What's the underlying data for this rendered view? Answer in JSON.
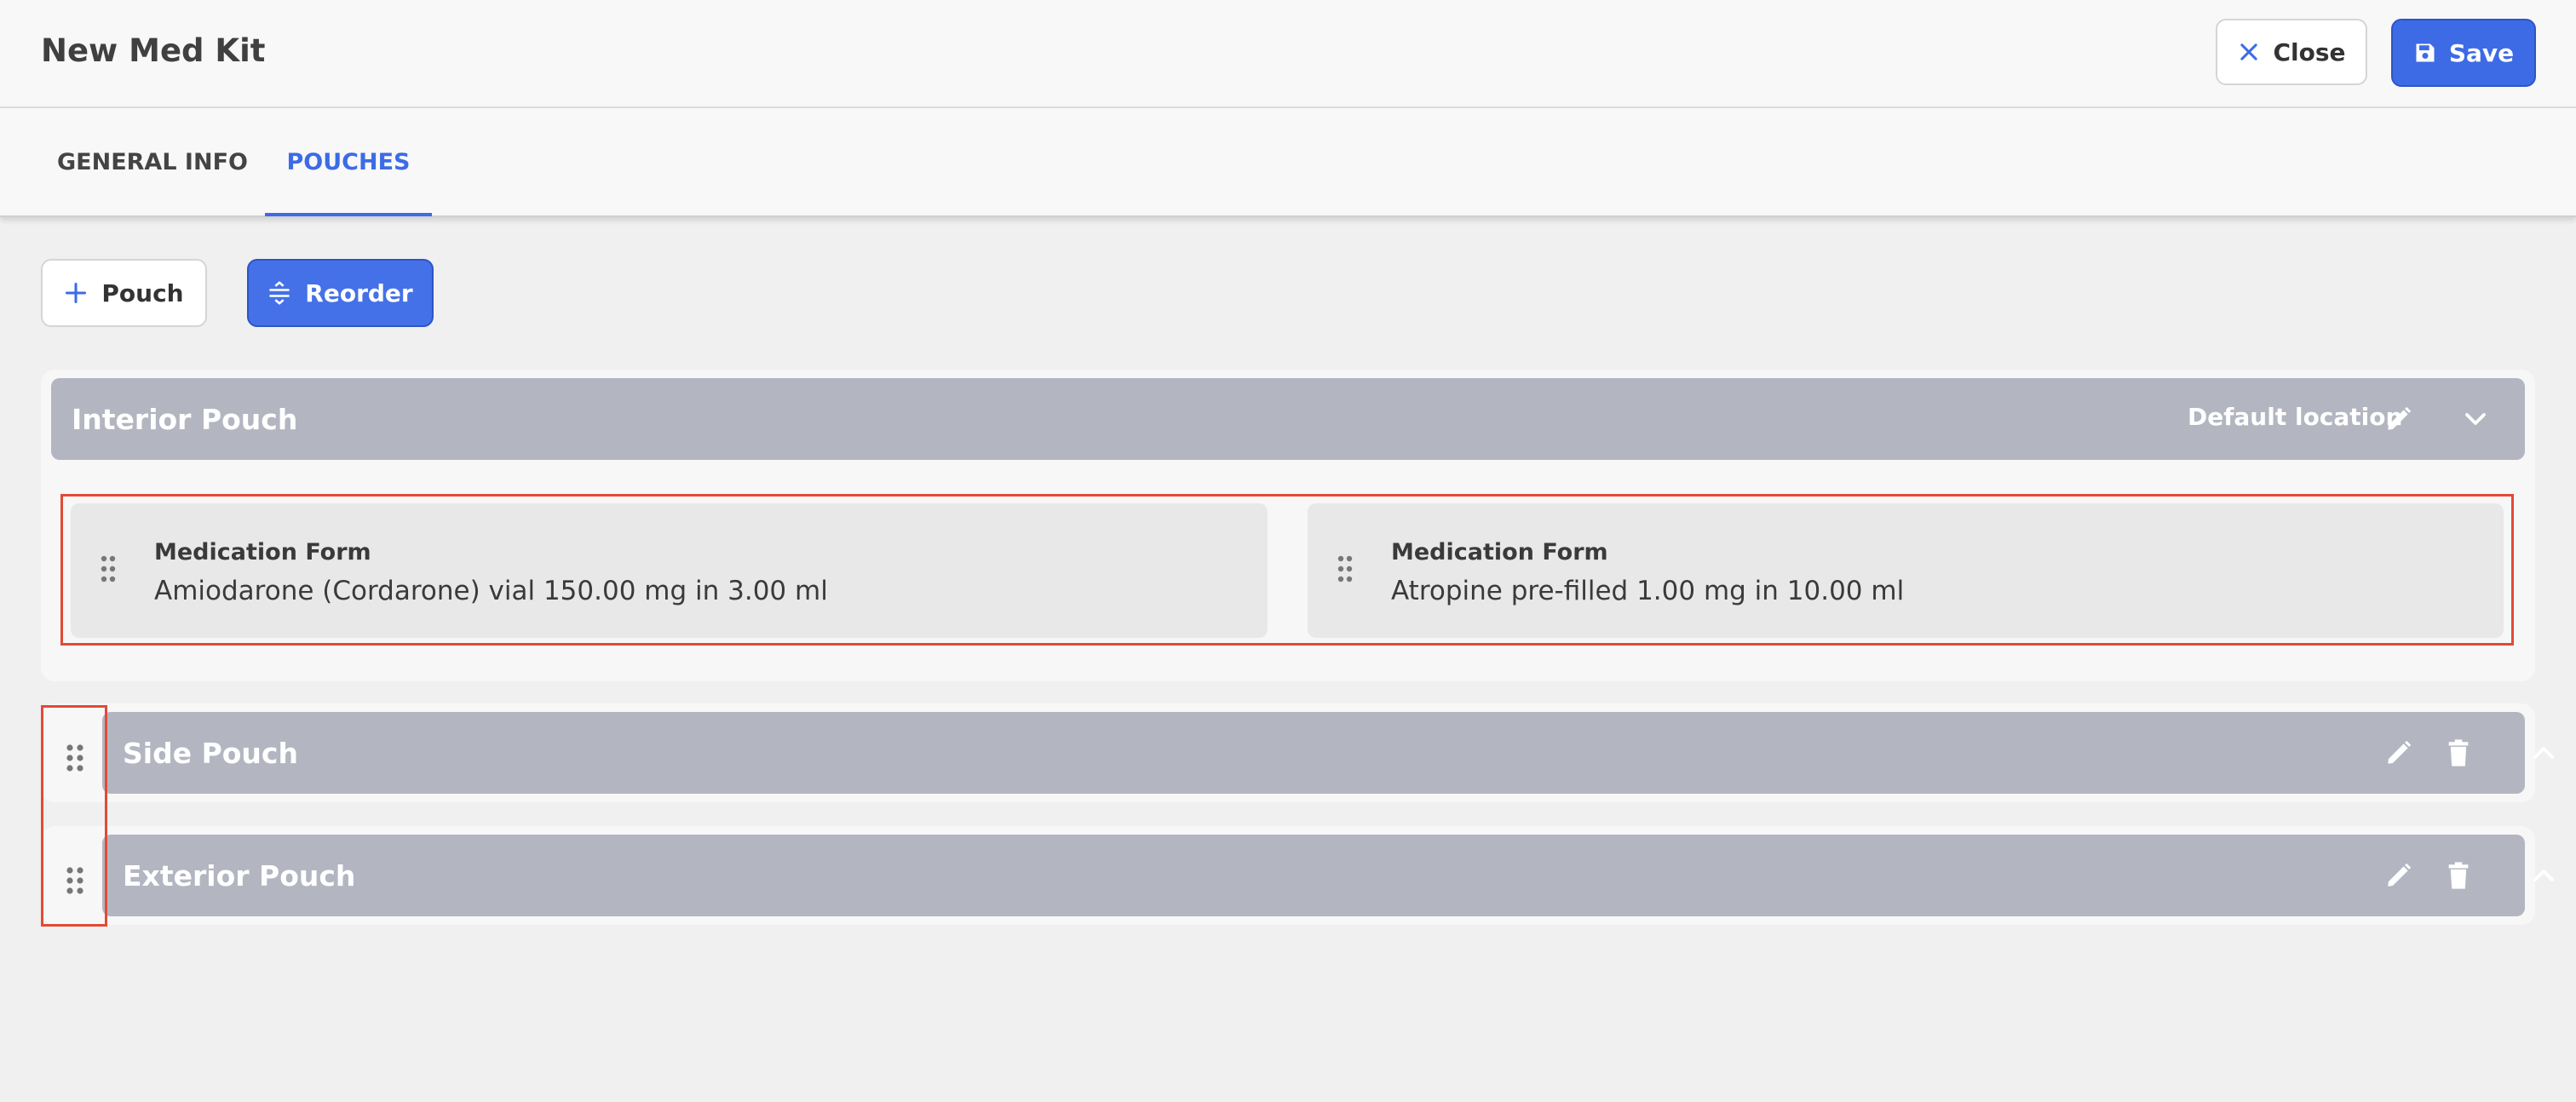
{
  "header": {
    "title": "New Med Kit",
    "close_label": "Close",
    "save_label": "Save"
  },
  "tabs": [
    {
      "label": "GENERAL INFO",
      "active": false
    },
    {
      "label": "POUCHES",
      "active": true
    }
  ],
  "actions": {
    "add_pouch_label": "Pouch",
    "reorder_label": "Reorder"
  },
  "pouches": [
    {
      "name": "Interior Pouch",
      "badge": "Default location",
      "expanded": true,
      "items": [
        {
          "label": "Medication Form",
          "value": "Amiodarone (Cordarone) vial 150.00 mg in 3.00 ml"
        },
        {
          "label": "Medication Form",
          "value": "Atropine pre-filled 1.00 mg in 10.00 ml"
        }
      ]
    },
    {
      "name": "Side Pouch",
      "expanded": false
    },
    {
      "name": "Exterior Pouch",
      "expanded": false
    }
  ],
  "colors": {
    "accent": "#3d6be6",
    "pouch_header": "#b3b6c1",
    "highlight": "#e24a35"
  }
}
